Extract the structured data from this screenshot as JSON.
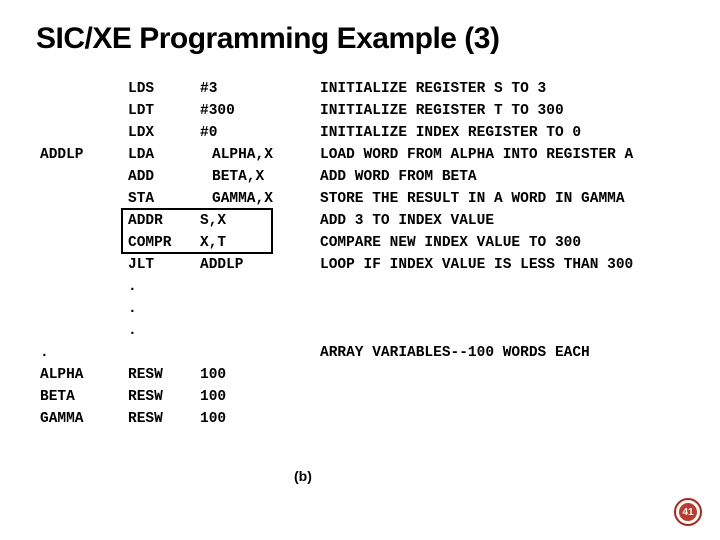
{
  "title": "SIC/XE Programming Example (3)",
  "code": [
    {
      "label": "",
      "mnem": "LDS",
      "oper": "#3",
      "indent": false,
      "cmt": "INITIALIZE REGISTER S TO 3"
    },
    {
      "label": "",
      "mnem": "LDT",
      "oper": "#300",
      "indent": false,
      "cmt": "INITIALIZE REGISTER T TO 300"
    },
    {
      "label": "",
      "mnem": "LDX",
      "oper": "#0",
      "indent": false,
      "cmt": "INITIALIZE INDEX REGISTER TO 0"
    },
    {
      "label": "ADDLP",
      "mnem": "LDA",
      "oper": "ALPHA,X",
      "indent": true,
      "cmt": "LOAD WORD FROM ALPHA INTO REGISTER A"
    },
    {
      "label": "",
      "mnem": "ADD",
      "oper": "BETA,X",
      "indent": true,
      "cmt": "ADD WORD FROM BETA"
    },
    {
      "label": "",
      "mnem": "STA",
      "oper": "GAMMA,X",
      "indent": true,
      "cmt": "STORE THE RESULT IN A WORD IN GAMMA"
    },
    {
      "label": "",
      "mnem": "ADDR",
      "oper": "S,X",
      "indent": false,
      "cmt": "ADD 3 TO INDEX VALUE"
    },
    {
      "label": "",
      "mnem": "COMPR",
      "oper": "X,T",
      "indent": false,
      "cmt": "COMPARE NEW INDEX VALUE TO 300"
    },
    {
      "label": "",
      "mnem": "JLT",
      "oper": "ADDLP",
      "indent": false,
      "cmt": "LOOP IF INDEX VALUE IS LESS THAN 300"
    },
    {
      "label": "",
      "mnem": ".",
      "oper": "",
      "indent": false,
      "cmt": ""
    },
    {
      "label": "",
      "mnem": ".",
      "oper": "",
      "indent": false,
      "cmt": ""
    },
    {
      "label": "",
      "mnem": ".",
      "oper": "",
      "indent": false,
      "cmt": ""
    },
    {
      "label": ".",
      "mnem": "",
      "oper": "",
      "indent": false,
      "cmt": "ARRAY VARIABLES--100 WORDS EACH"
    },
    {
      "label": "ALPHA",
      "mnem": "RESW",
      "oper": "100",
      "indent": false,
      "cmt": ""
    },
    {
      "label": "BETA",
      "mnem": "RESW",
      "oper": "100",
      "indent": false,
      "cmt": ""
    },
    {
      "label": "GAMMA",
      "mnem": "RESW",
      "oper": "100",
      "indent": false,
      "cmt": ""
    }
  ],
  "sub_label": "(b)",
  "page_number": "41"
}
